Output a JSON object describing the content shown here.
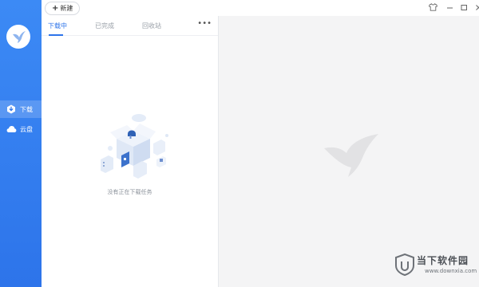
{
  "toolbar": {
    "new_label": "新建"
  },
  "sidebar": {
    "items": [
      {
        "label": "下载",
        "active": true,
        "icon": "download-hex-icon"
      },
      {
        "label": "云盘",
        "active": false,
        "icon": "cloud-icon"
      }
    ]
  },
  "tabs": [
    {
      "label": "下载中",
      "active": true
    },
    {
      "label": "已完成",
      "active": false
    },
    {
      "label": "回收站",
      "active": false
    }
  ],
  "more_label": "•••",
  "empty_state": {
    "text": "没有正在下载任务"
  },
  "watermark": {
    "site_name": "当下软件园",
    "site_url": "www.downxia.com"
  },
  "colors": {
    "accent": "#2d74ea",
    "sidebar": "#3c8af5",
    "right_bg": "#f4f4f5"
  }
}
